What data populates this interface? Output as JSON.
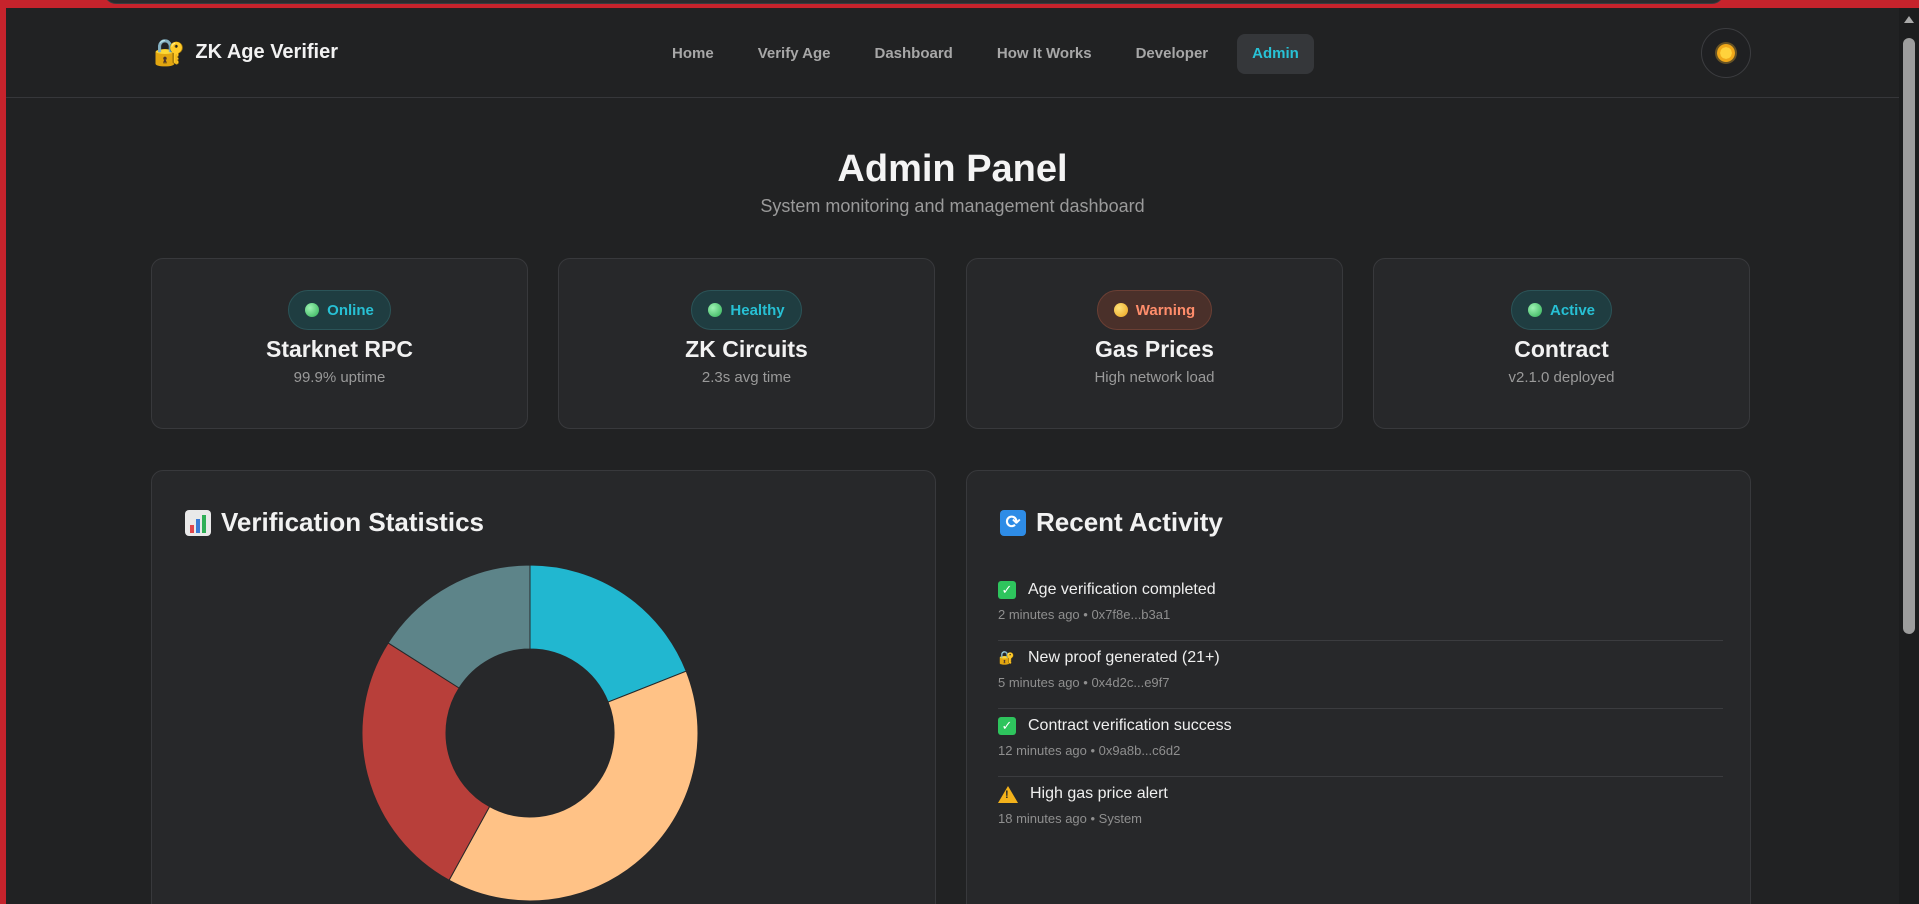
{
  "nav": {
    "brand": "ZK Age Verifier",
    "links": [
      {
        "label": "Home",
        "active": false
      },
      {
        "label": "Verify Age",
        "active": false
      },
      {
        "label": "Dashboard",
        "active": false
      },
      {
        "label": "How It Works",
        "active": false
      },
      {
        "label": "Developer",
        "active": false
      },
      {
        "label": "Admin",
        "active": true
      }
    ],
    "theme_icon": "sun-icon"
  },
  "header": {
    "title": "Admin Panel",
    "subtitle": "System monitoring and management dashboard"
  },
  "status_cards": [
    {
      "badge": "Online",
      "status": "good",
      "title": "Starknet RPC",
      "sub": "99.9% uptime"
    },
    {
      "badge": "Healthy",
      "status": "good",
      "title": "ZK Circuits",
      "sub": "2.3s avg time"
    },
    {
      "badge": "Warning",
      "status": "warn",
      "title": "Gas Prices",
      "sub": "High network load"
    },
    {
      "badge": "Active",
      "status": "good",
      "title": "Contract",
      "sub": "v2.1.0 deployed"
    }
  ],
  "stats_panel": {
    "title": "Verification Statistics",
    "icon": "bar-chart-icon"
  },
  "chart_data": {
    "type": "pie",
    "values": [
      19,
      39,
      26,
      16
    ],
    "colors": [
      "#21b7d0",
      "#ffc286",
      "#b83f3a",
      "#5d8489"
    ],
    "title": ""
  },
  "activity_panel": {
    "title": "Recent Activity",
    "icon": "refresh-icon",
    "items": [
      {
        "icon": "check-icon",
        "text": "Age verification completed",
        "meta": "2 minutes ago • 0x7f8e...b3a1"
      },
      {
        "icon": "lock-icon",
        "text": "New proof generated (21+)",
        "meta": "5 minutes ago • 0x4d2c...e9f7"
      },
      {
        "icon": "check-icon",
        "text": "Contract verification success",
        "meta": "12 minutes ago • 0x9a8b...c6d2"
      },
      {
        "icon": "warning-icon",
        "text": "High gas price alert",
        "meta": "18 minutes ago • System"
      }
    ]
  }
}
